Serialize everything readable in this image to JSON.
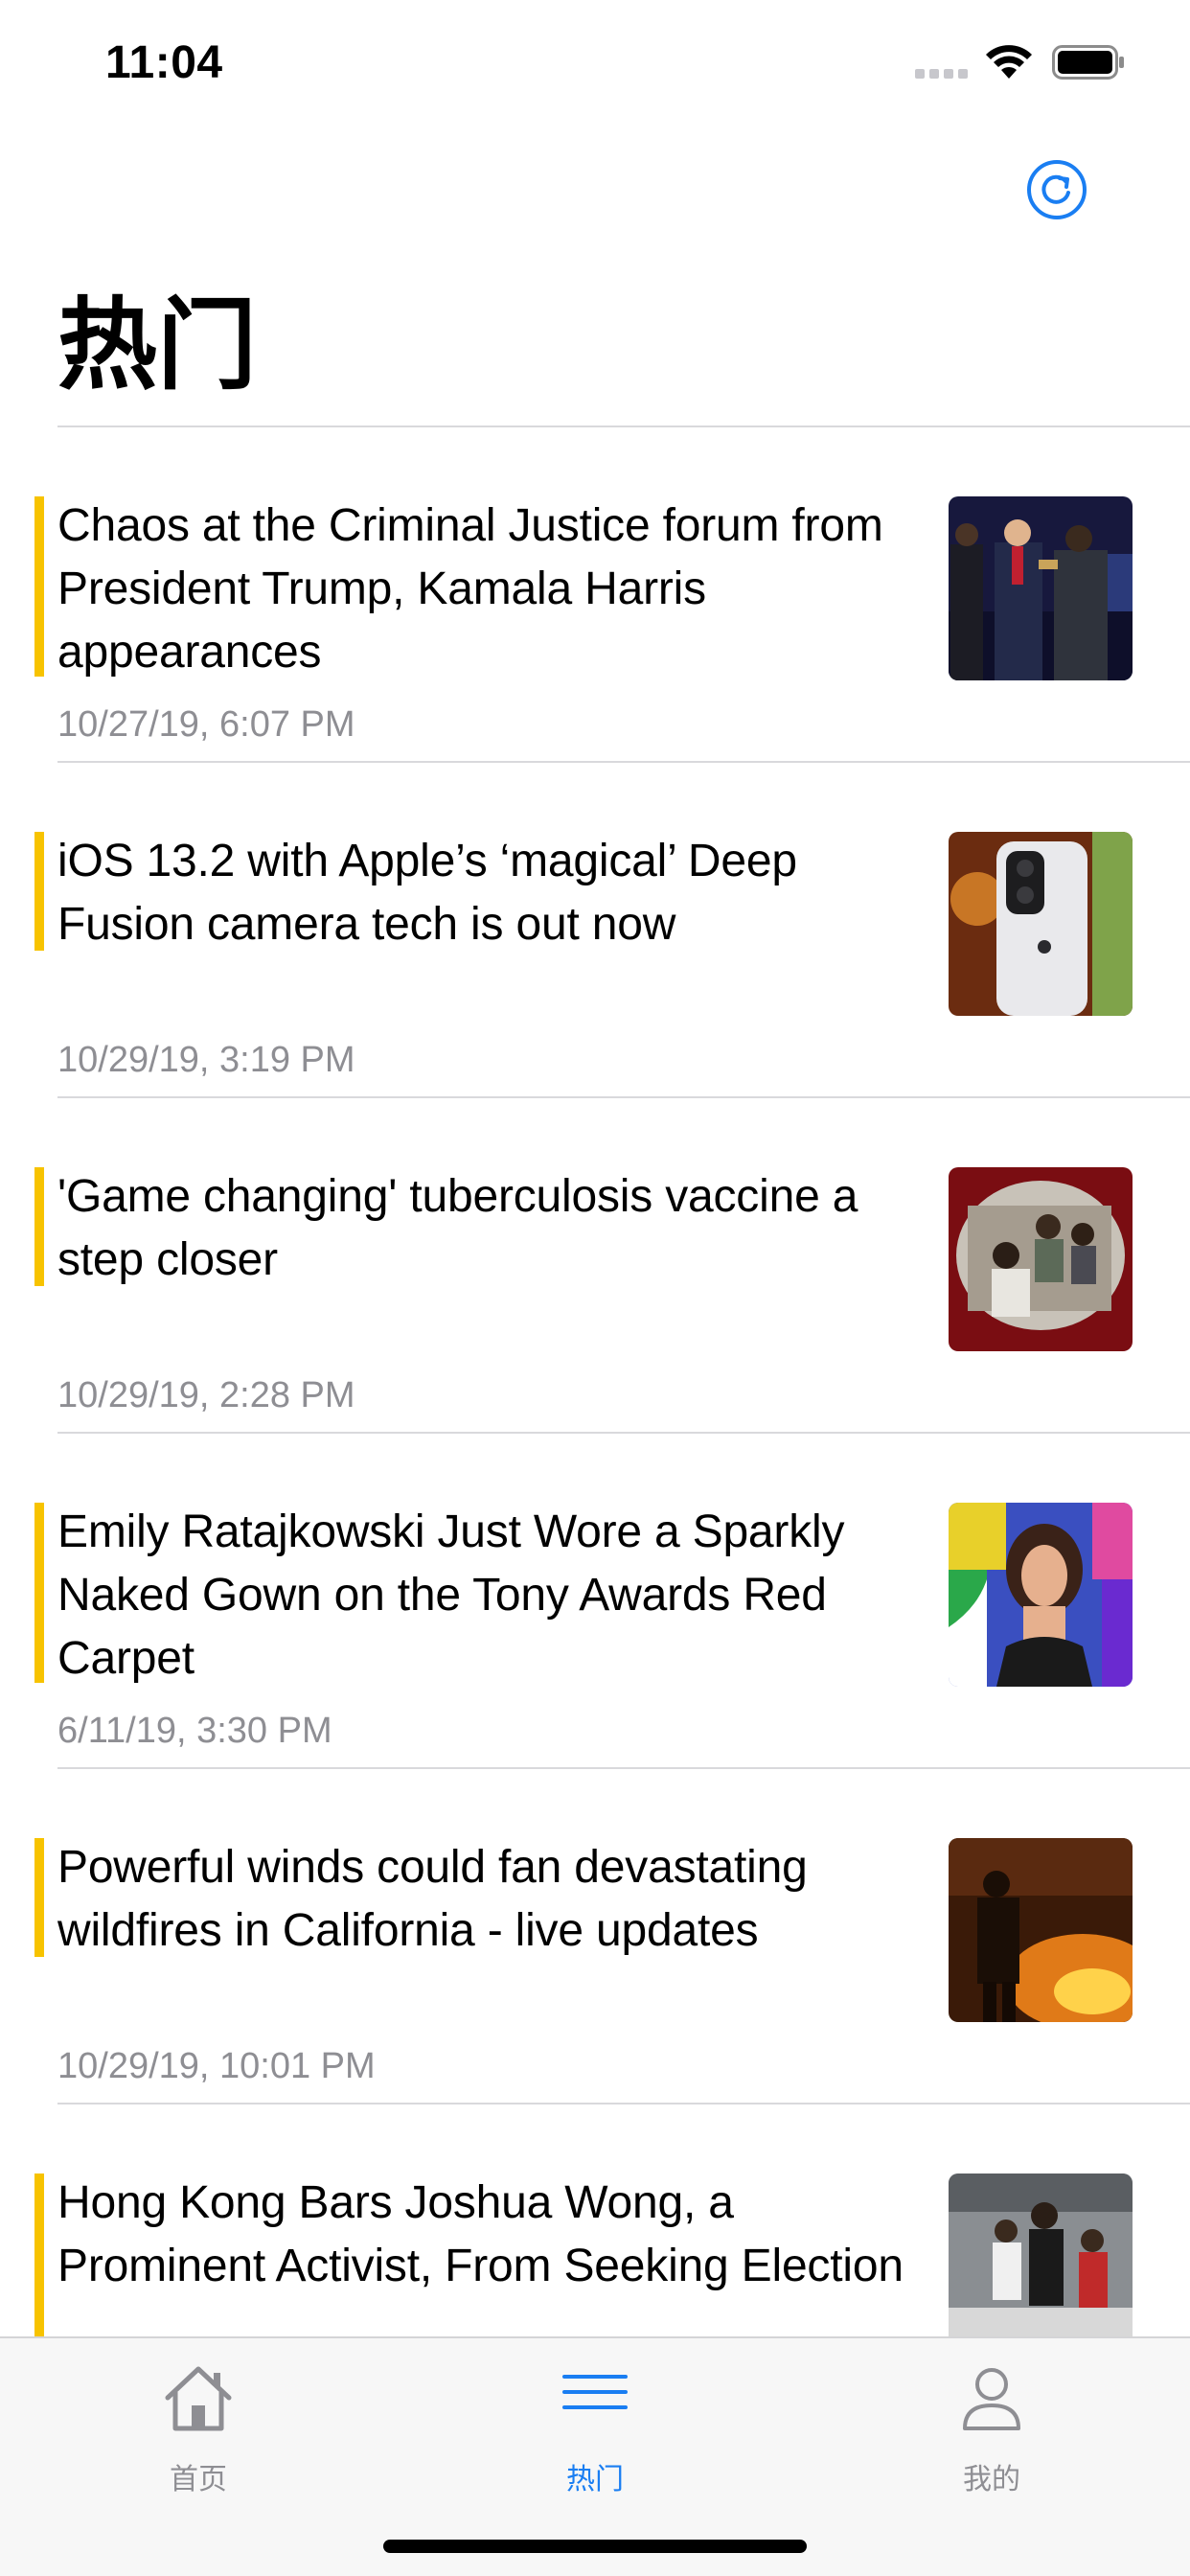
{
  "status_bar": {
    "time": "11:04"
  },
  "header": {
    "title": "热门",
    "refresh_icon": "refresh-icon"
  },
  "colors": {
    "accent_bar": "#f7c300",
    "tab_active": "#1a7ef2",
    "tab_inactive": "#8e8e93",
    "date_text": "#8e8e93"
  },
  "news": [
    {
      "headline": "Chaos at the Criminal Justice forum from President Trump, Kamala Harris appearances",
      "date": "10/27/19, 6:07 PM"
    },
    {
      "headline": "iOS 13.2 with Apple’s ‘magical’ Deep Fusion camera tech is out now",
      "date": "10/29/19, 3:19 PM"
    },
    {
      "headline": "'Game changing' tuberculosis vaccine a step closer",
      "date": "10/29/19, 2:28 PM"
    },
    {
      "headline": "Emily Ratajkowski Just Wore a Sparkly Naked Gown on the Tony Awards Red Carpet",
      "date": "6/11/19, 3:30 PM"
    },
    {
      "headline": "Powerful winds could fan devastating wildfires in California - live updates",
      "date": "10/29/19, 10:01 PM"
    },
    {
      "headline": "Hong Kong Bars Joshua Wong, a Prominent Activist, From Seeking Election",
      "date": ""
    }
  ],
  "tab_bar": {
    "tabs": [
      {
        "label": "首页",
        "icon": "house-icon",
        "active": false
      },
      {
        "label": "热门",
        "icon": "list-icon",
        "active": true
      },
      {
        "label": "我的",
        "icon": "person-icon",
        "active": false
      }
    ]
  }
}
